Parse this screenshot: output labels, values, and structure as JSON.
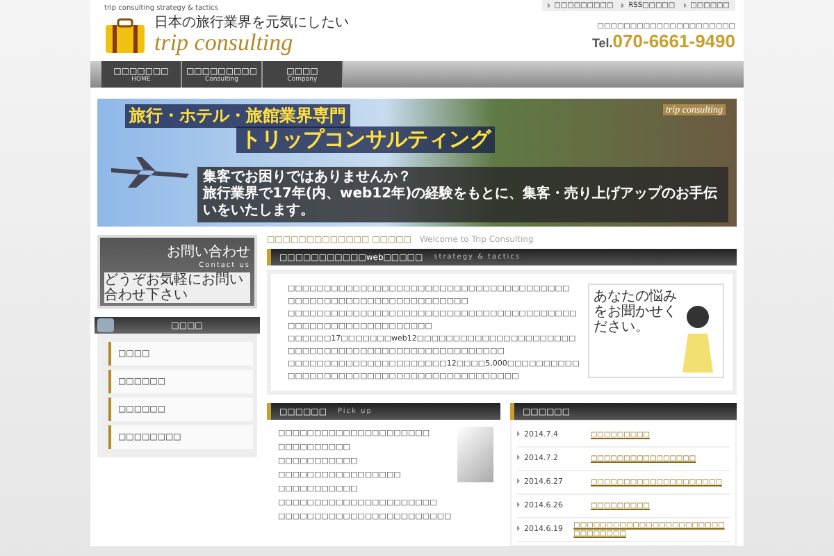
{
  "header": {
    "tagline": "trip consulting strategy & tactics",
    "logo_slogan": "日本の旅行業界を元気にしたい",
    "logo_name": "trip consulting",
    "top_links": [
      "□□□□□□□□□",
      "RSS□□□□□",
      "□□□□□□"
    ],
    "contact_note": "□□□□□□□□□□□□□□□□□□□□□",
    "tel_label": "Tel.",
    "tel_number": "070-6661-9490"
  },
  "nav": [
    {
      "label": "□□□□□□□",
      "sub": "HOME",
      "selected": false
    },
    {
      "label": "□□□□□□□□□",
      "sub": "Consulting",
      "selected": false
    },
    {
      "label": "□□□□",
      "sub": "Company",
      "selected": false
    }
  ],
  "banner": {
    "title": "旅行・ホテル・旅館業界専門",
    "headline": "トリップコンサルティング",
    "badge": "trip consulting",
    "question": "集客でお困りではありませんか？",
    "message": "旅行業界で17年(内、web12年)の経験をもとに、集客・売り上げアップのお手伝いをいたします。"
  },
  "contact": {
    "title": "お問い合わせ",
    "sub": "Contact us",
    "note": "どうぞお気軽にお問い合わせ下さい"
  },
  "menu": {
    "title": "□□□□",
    "items": [
      "□□□□",
      "□□□□□□",
      "□□□□□□",
      "□□□□□□□□"
    ]
  },
  "welcome": {
    "jp": "□□□□□□□□□□□□□ □□□□□",
    "en": "Welcome to Trip Consulting"
  },
  "intro": {
    "title": "□□□□□□□□□□□web□□□□□",
    "en": "strategy & tactics",
    "paragraphs": [
      "□□□□□□□□□□□□□□□□□□□□□□□□□□□□□□□□□□□□□□□",
      "□□□□□□□□□□□□□□□□□□□□□□□□□",
      "□□□□□□□□□□□□□□□□□□□□□□□□□□□□□□□□□□□□□□□□□□□□□□□□□□□□□□□□□□□□",
      "□□□□□□17□□□□□□□web12□□□□□□□□□□□□□□□□□□□□□□□□□□□□□□□□□□□□□□□□□□□□□□□□□□□□",
      "□□□□□□□□□□□□□□□□□□□□□□12□□□□5,000□□□□□□□□□□□□□□□□□□□□□□□□□□□□□□□□□□□□□□□□□□"
    ],
    "bubble": "あなたの悩みをお聞かせください。"
  },
  "pickup": {
    "title": "□□□□□□",
    "en": "Pick up",
    "items": [
      "□□□□□□□□□□□□□□□□□□□□□",
      "□□□□□□□□□□",
      "□□□□□□□□□□□",
      "□□□□□□□□□□□□□□□□□",
      "□□□□□□□□□□□",
      "□□□□□□□□□□□□□□□□□□□□□□",
      "□□□□□□□□□□□□□□□□□□□□□□□□"
    ]
  },
  "news": {
    "title": "□□□□□□",
    "items": [
      {
        "date": "2014.7.4",
        "text": "□□□□□□□□□"
      },
      {
        "date": "2014.7.2",
        "text": "□□□□□□□□□□□□□□□□"
      },
      {
        "date": "2014.6.27",
        "text": "□□□□□□□□□□□□□□□□□□□□"
      },
      {
        "date": "2014.6.26",
        "text": "□□□□□□□□□"
      },
      {
        "date": "2014.6.19",
        "text": "□□□□□□□□□□□□□□□□□□□□□□□□□□□□□□□"
      }
    ]
  }
}
